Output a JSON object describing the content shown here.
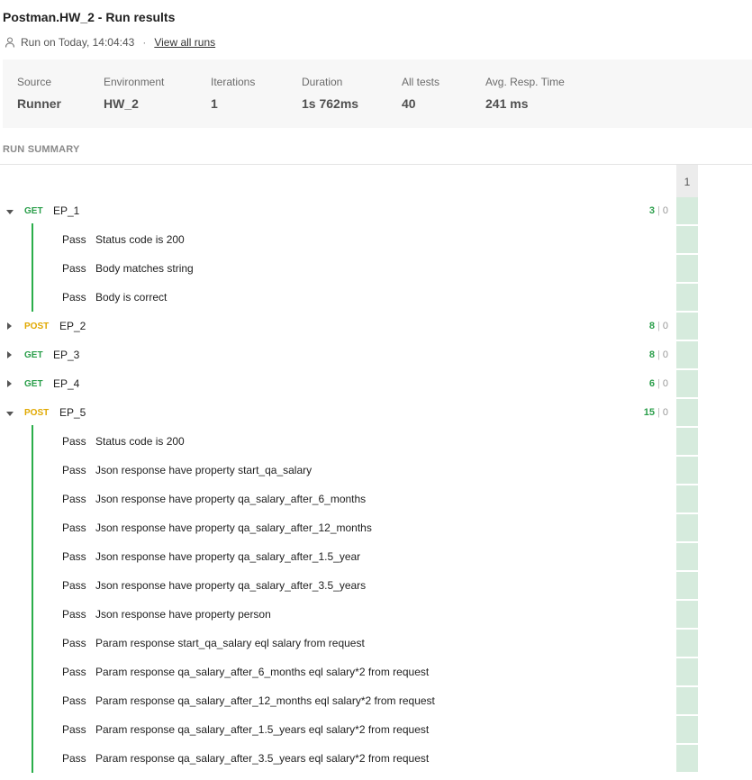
{
  "header": {
    "title": "Postman.HW_2 - Run results",
    "run_on": "Run on Today, 14:04:43",
    "separator": "·",
    "view_all_runs": "View all runs"
  },
  "stats": [
    {
      "label": "Source",
      "value": "Runner"
    },
    {
      "label": "Environment",
      "value": "HW_2"
    },
    {
      "label": "Iterations",
      "value": "1"
    },
    {
      "label": "Duration",
      "value": "1s 762ms"
    },
    {
      "label": "All tests",
      "value": "40"
    },
    {
      "label": "Avg. Resp. Time",
      "value": "241 ms"
    }
  ],
  "summary": {
    "label": "RUN SUMMARY",
    "iteration_header": "1"
  },
  "requests": [
    {
      "method": "GET",
      "name": "EP_1",
      "expanded": true,
      "passed": "3",
      "failed": "0",
      "tests": [
        {
          "status": "Pass",
          "name": "Status code is 200"
        },
        {
          "status": "Pass",
          "name": "Body matches string"
        },
        {
          "status": "Pass",
          "name": "Body is correct"
        }
      ]
    },
    {
      "method": "POST",
      "name": "EP_2",
      "expanded": false,
      "passed": "8",
      "failed": "0",
      "tests": []
    },
    {
      "method": "GET",
      "name": "EP_3",
      "expanded": false,
      "passed": "8",
      "failed": "0",
      "tests": []
    },
    {
      "method": "GET",
      "name": "EP_4",
      "expanded": false,
      "passed": "6",
      "failed": "0",
      "tests": []
    },
    {
      "method": "POST",
      "name": "EP_5",
      "expanded": true,
      "passed": "15",
      "failed": "0",
      "tests": [
        {
          "status": "Pass",
          "name": "Status code is 200"
        },
        {
          "status": "Pass",
          "name": "Json response have property start_qa_salary"
        },
        {
          "status": "Pass",
          "name": "Json response have property qa_salary_after_6_months"
        },
        {
          "status": "Pass",
          "name": "Json response have property qa_salary_after_12_months"
        },
        {
          "status": "Pass",
          "name": "Json response have property qa_salary_after_1.5_year"
        },
        {
          "status": "Pass",
          "name": "Json response have property qa_salary_after_3.5_years"
        },
        {
          "status": "Pass",
          "name": "Json response have property person"
        },
        {
          "status": "Pass",
          "name": "Param response start_qa_salary eql salary from request"
        },
        {
          "status": "Pass",
          "name": "Param response qa_salary_after_6_months eql salary*2 from request"
        },
        {
          "status": "Pass",
          "name": "Param response qa_salary_after_12_months eql salary*2 from request"
        },
        {
          "status": "Pass",
          "name": "Param response qa_salary_after_1.5_years eql salary*2 from request"
        },
        {
          "status": "Pass",
          "name": "Param response qa_salary_after_3.5_years eql salary*2 from request"
        }
      ]
    }
  ],
  "colors": {
    "get": "#2a9e4a",
    "post": "#e0a800",
    "pass_bar": "#2aae4a",
    "iteration_pass": "#d6ebdd"
  },
  "icons": {
    "user": "user-icon",
    "expanded": "caret-down-icon",
    "collapsed": "caret-right-icon"
  }
}
